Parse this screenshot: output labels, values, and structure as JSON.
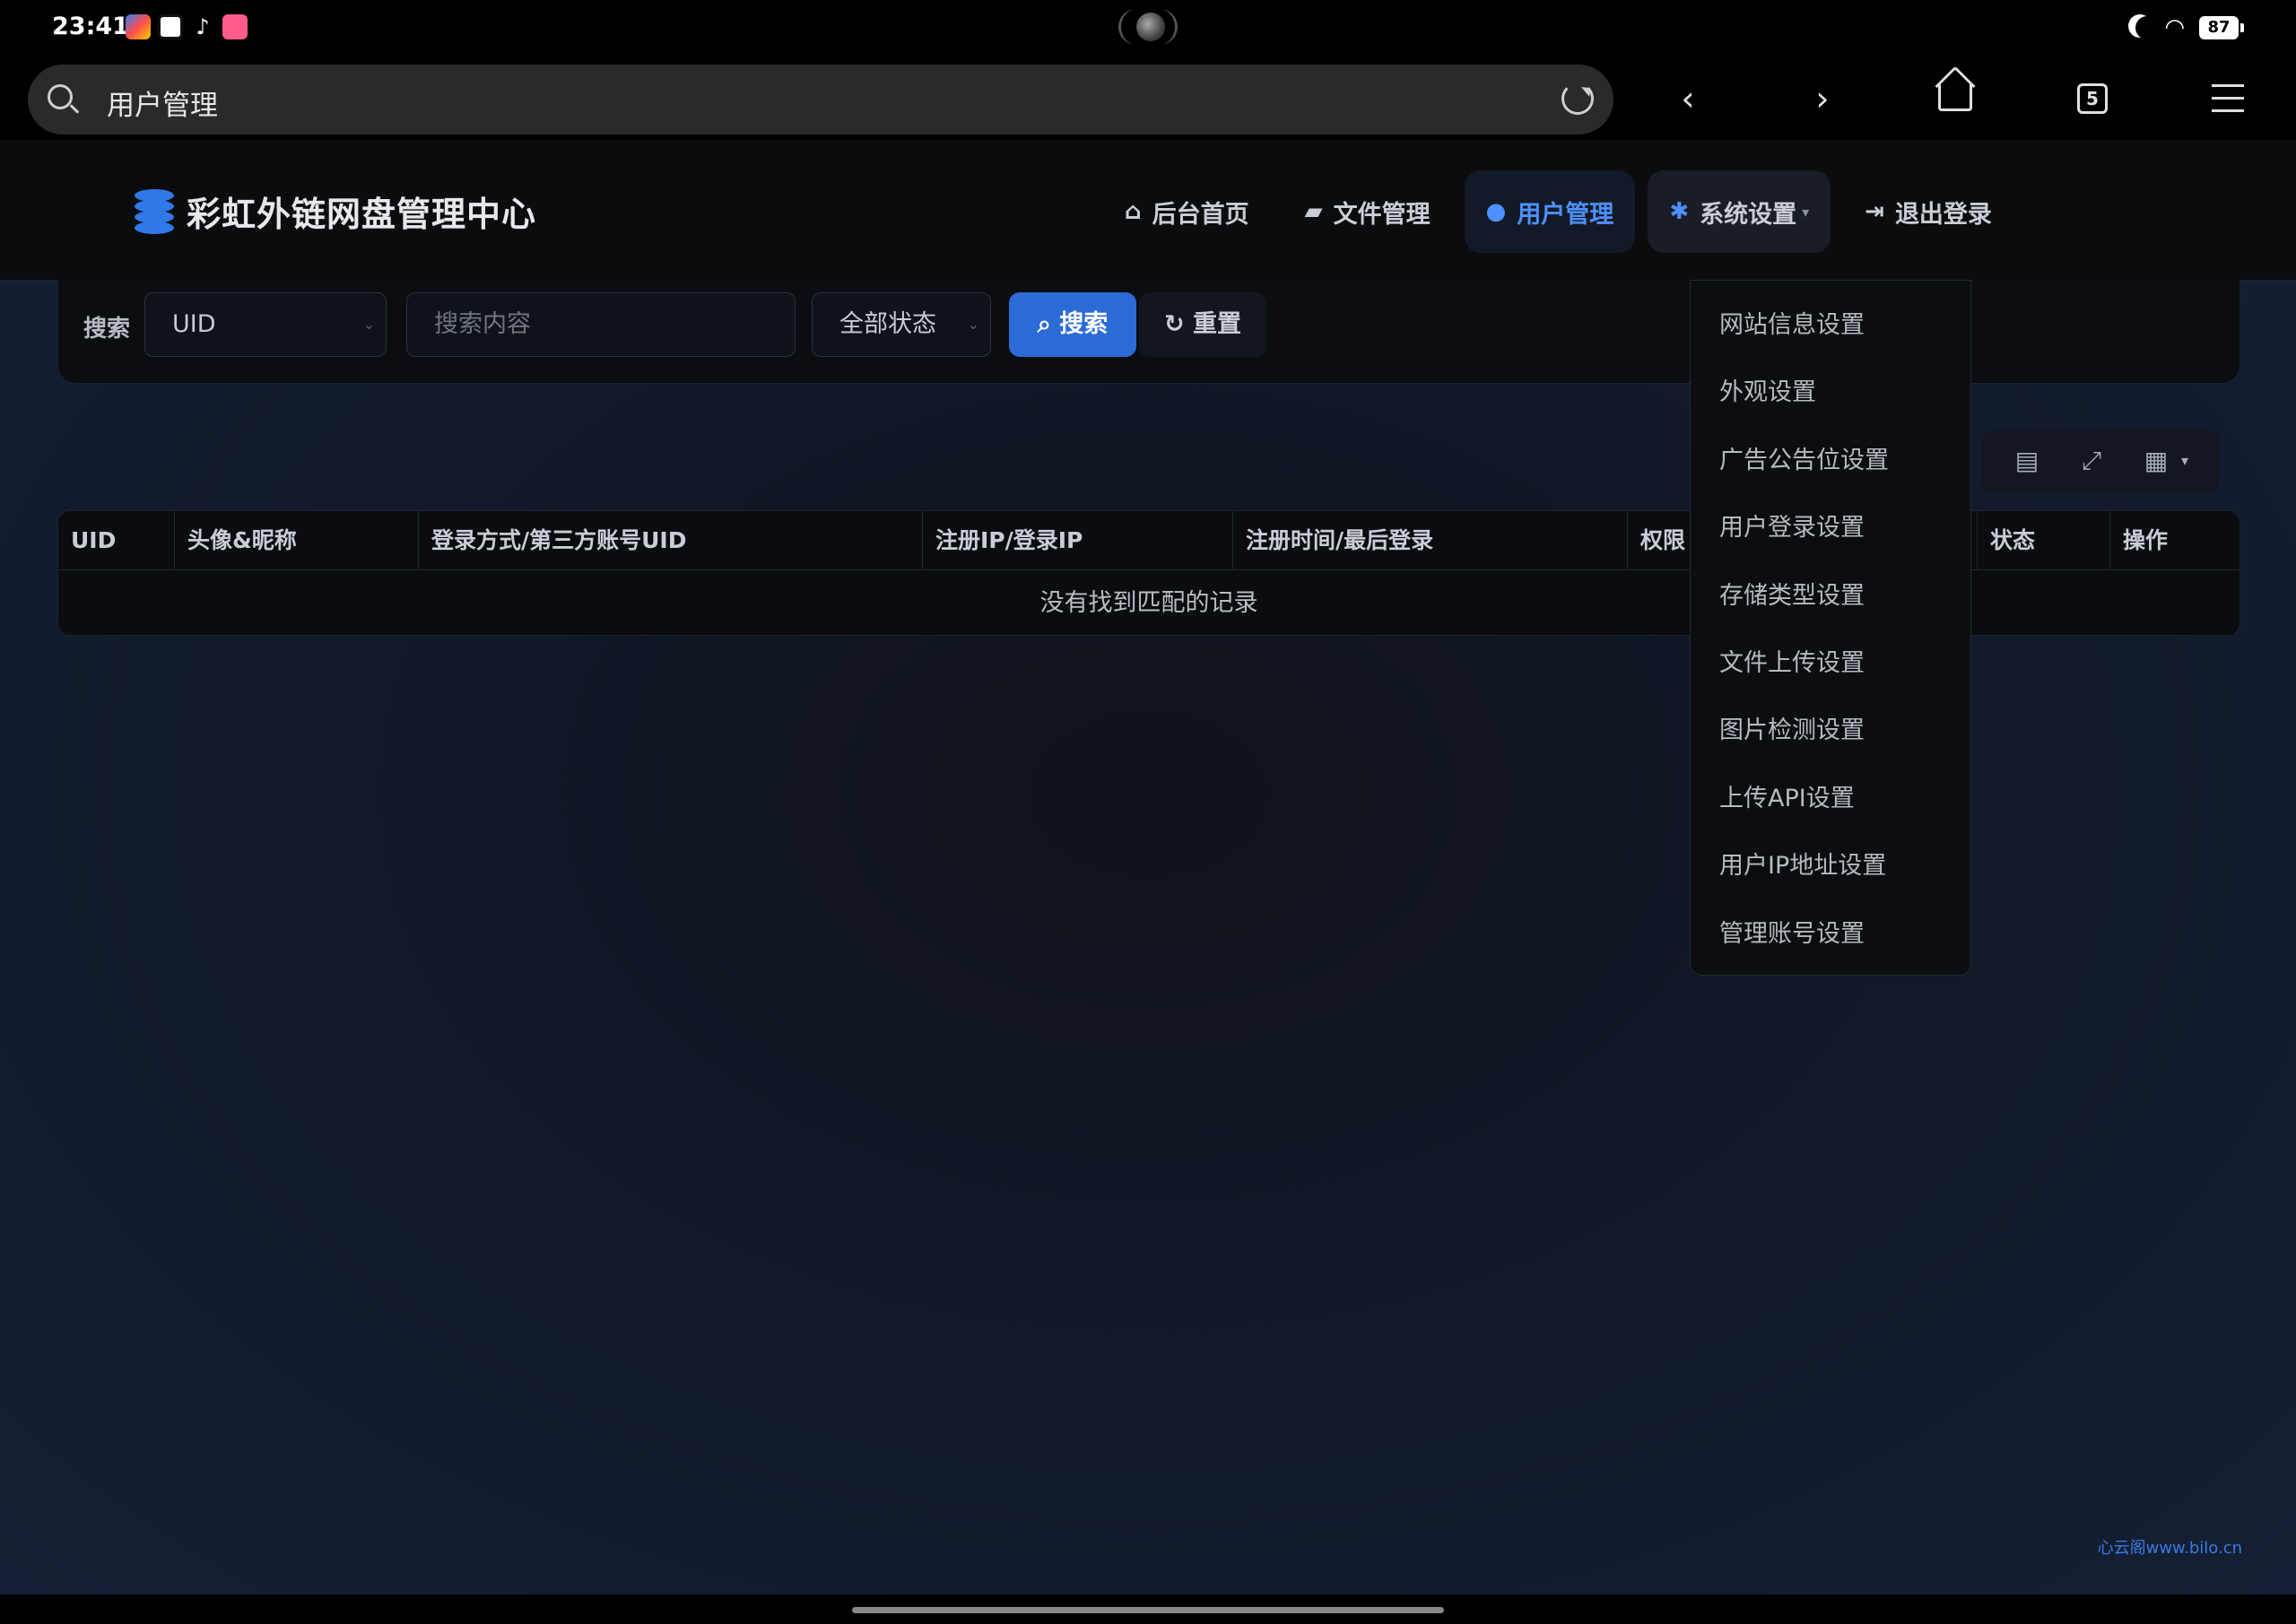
{
  "status_bar": {
    "time": "23:41",
    "battery": "87"
  },
  "browser": {
    "url_text": "用户管理",
    "tab_count": "5"
  },
  "site": {
    "brand": "彩虹外链网盘管理中心",
    "nav": [
      {
        "label": "后台首页",
        "icon": "home-icon"
      },
      {
        "label": "文件管理",
        "icon": "folder-open-icon"
      },
      {
        "label": "用户管理",
        "icon": "users-icon"
      },
      {
        "label": "系统设置",
        "icon": "gear-icon"
      },
      {
        "label": "退出登录",
        "icon": "sign-out-icon"
      }
    ],
    "active_nav": "用户管理",
    "accent_color": "#2a6bd6"
  },
  "search": {
    "label": "搜索",
    "field_type": "UID",
    "placeholder": "搜索内容",
    "status": "全部状态",
    "search_button": "搜索",
    "reset_button": "重置"
  },
  "table": {
    "columns": [
      "UID",
      "头像&昵称",
      "登录方式/第三方账号UID",
      "注册IP/登录IP",
      "注册时间/最后登录",
      "权限",
      "状态",
      "操作"
    ],
    "empty_text": "没有找到匹配的记录"
  },
  "dropdown": {
    "items": [
      "网站信息设置",
      "外观设置",
      "广告公告位设置",
      "用户登录设置",
      "存储类型设置",
      "文件上传设置",
      "图片检测设置",
      "上传API设置",
      "用户IP地址设置",
      "管理账号设置"
    ]
  },
  "watermark": "心云阁www.bilo.cn"
}
